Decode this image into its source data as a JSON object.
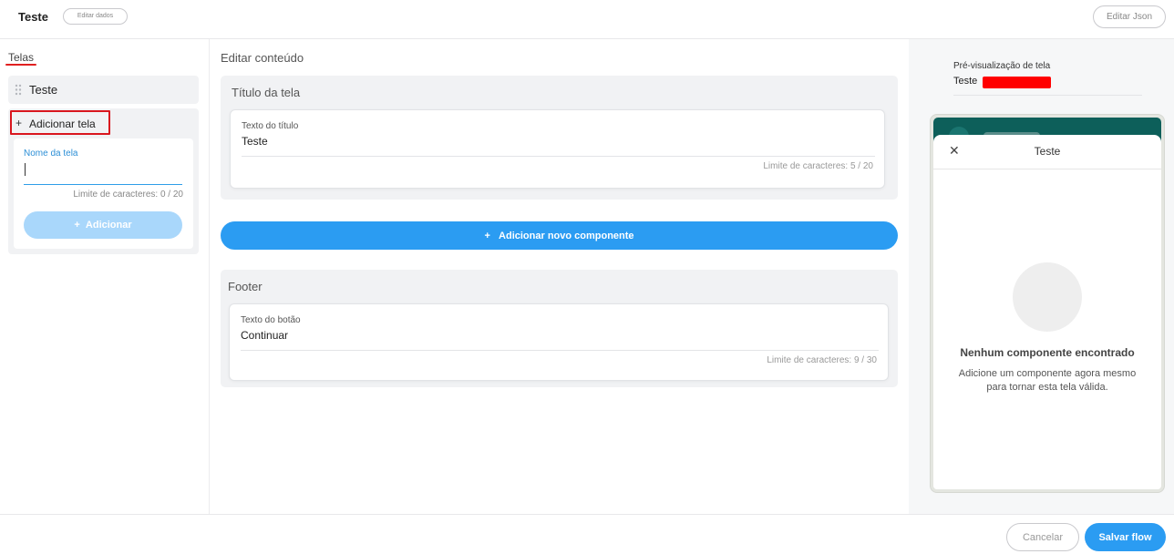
{
  "header": {
    "flow_title": "Teste",
    "edit_data_label": "Editar dados",
    "edit_json_label": "Editar Json"
  },
  "sidebar": {
    "heading": "Telas",
    "screens": [
      {
        "label": "Teste"
      }
    ],
    "add_screen_label": "Adicionar tela",
    "add_form": {
      "name_label": "Nome da tela",
      "name_value": "",
      "limit_text": "Limite de caracteres: 0 / 20",
      "add_button_label": "Adicionar"
    }
  },
  "editor": {
    "heading": "Editar conteúdo",
    "title_section": {
      "title": "Título da tela",
      "field_label": "Texto do título",
      "field_value": "Teste",
      "limit_text": "Limite de caracteres: 5 / 20"
    },
    "add_component_label": "Adicionar novo componente",
    "footer_section": {
      "title": "Footer",
      "field_label": "Texto do botão",
      "field_value": "Continuar",
      "limit_text": "Limite de caracteres: 9 / 30"
    }
  },
  "preview": {
    "heading": "Pré-visualização de tela",
    "screen_name": "Teste",
    "sheet_title": "Teste",
    "empty_title": "Nenhum componente encontrado",
    "empty_description": "Adicione um componente agora mesmo para tornar esta tela válida."
  },
  "footer": {
    "cancel_label": "Cancelar",
    "save_label": "Salvar flow"
  },
  "colors": {
    "primary": "#2b9cf2",
    "primary_disabled": "#a9d7fb",
    "highlight_red": "#d9161e",
    "phone_header": "#0d5f5a"
  }
}
